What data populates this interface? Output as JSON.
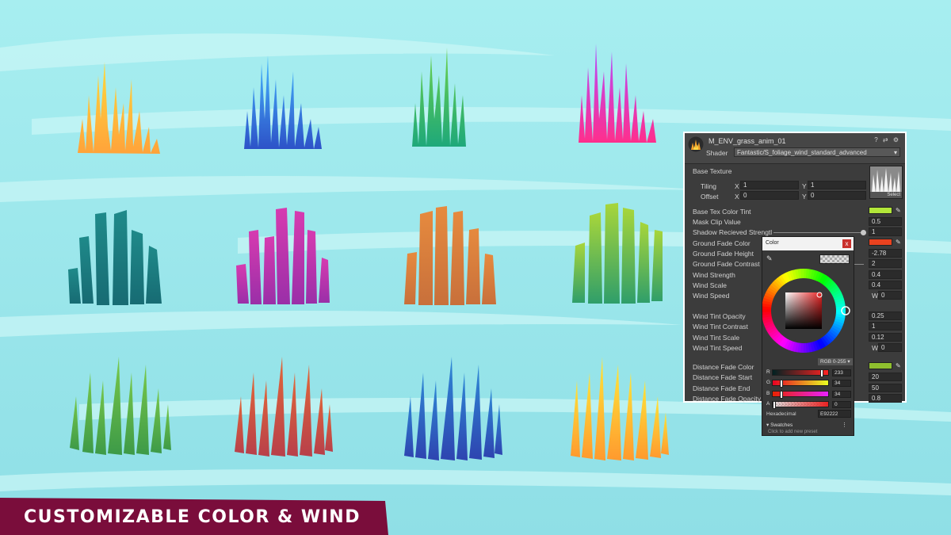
{
  "banner": {
    "text": "CUSTOMIZABLE COLOR & WIND",
    "color": "#7a0d3b"
  },
  "inspector": {
    "title": "M_ENV_grass_anim_01",
    "icons": "? ⇄ ⚙",
    "shader_label": "Shader",
    "shader_value": "Fantastic/S_foliage_wind_standard_advanced",
    "base_texture_label": "Base Texture",
    "tiling_label": "Tiling",
    "offset_label": "Offset",
    "tiling_x": "1",
    "tiling_y": "1",
    "offset_x": "0",
    "offset_y": "0",
    "x_label": "X",
    "y_label": "Y",
    "select_label": "Select",
    "properties": [
      {
        "label": "Base Tex Color Tint",
        "type": "color",
        "color": "#b2e639"
      },
      {
        "label": "Mask Clip Value",
        "value": "0.5"
      },
      {
        "label": "Shadow Recieved Strengtl",
        "value": "1",
        "slider": 1.0
      },
      {
        "label": "Ground Fade Color",
        "type": "color",
        "color": "#e9421f"
      },
      {
        "label": "Ground Fade Height",
        "value": "-2.78"
      },
      {
        "label": "Ground Fade Contrast",
        "value": "2",
        "slider": 0.5
      },
      {
        "label": "Wind Strength",
        "value": "0.4"
      },
      {
        "label": "Wind Scale",
        "value": "0.4"
      },
      {
        "label": "Wind Speed",
        "value": "0",
        "prefix": "W"
      },
      {
        "label": "Wind Tint Opacity",
        "value": "0.25"
      },
      {
        "label": "Wind Tint Contrast",
        "value": "1"
      },
      {
        "label": "Wind Tint Scale",
        "value": "0.12"
      },
      {
        "label": "Wind Tint Speed",
        "value": "0",
        "prefix": "W"
      },
      {
        "label": "Distance Fade Color",
        "type": "color",
        "color": "#8fbf2e"
      },
      {
        "label": "Distance Fade Start",
        "value": "20"
      },
      {
        "label": "Distance Fade End",
        "value": "50"
      },
      {
        "label": "Distance Fade Opacity",
        "value": "0.8"
      }
    ]
  },
  "color_picker": {
    "title": "Color",
    "close": "x",
    "mode": "RGB 0-255 ▾",
    "channels": [
      {
        "name": "R",
        "value": "233",
        "level": 233
      },
      {
        "name": "G",
        "value": "34",
        "level": 34
      },
      {
        "name": "B",
        "value": "34",
        "level": 34
      },
      {
        "name": "A",
        "value": "0",
        "level": 0
      }
    ],
    "hex_label": "Hexadecimal",
    "hex_value": "E92222",
    "swatches_label": "▾ Swatches",
    "swatches_more": "⋮",
    "add_preset": "Click to add new preset",
    "current_color": "#e92222"
  }
}
